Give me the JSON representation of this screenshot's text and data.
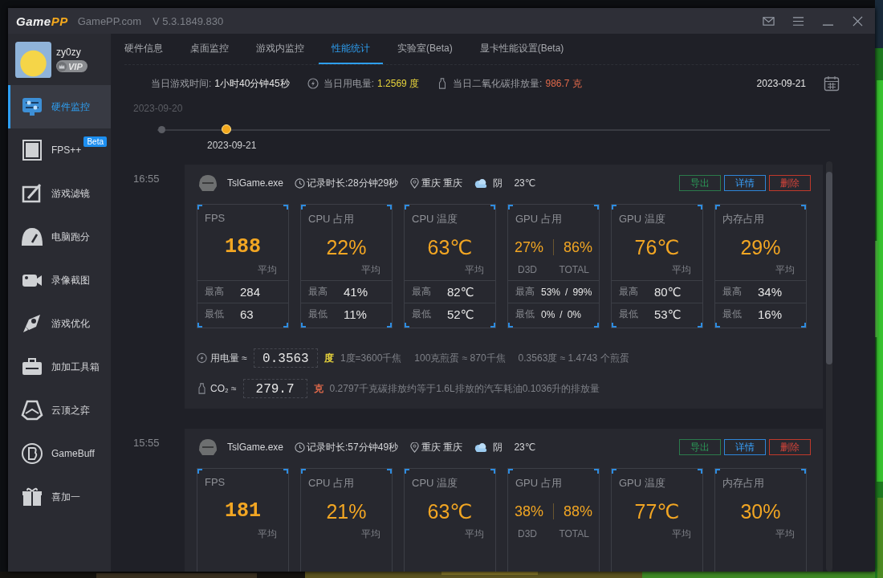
{
  "window": {
    "logo": "GamePP",
    "site": "GamePP.com",
    "version": "V 5.3.1849.830"
  },
  "user": {
    "name": "zy0zy",
    "badge": "VIP"
  },
  "sidebar": {
    "items": [
      {
        "label": "硬件监控",
        "selected": true
      },
      {
        "label": "FPS++",
        "selected": false,
        "badge": "Beta"
      },
      {
        "label": "游戏滤镜",
        "selected": false
      },
      {
        "label": "电脑跑分",
        "selected": false
      },
      {
        "label": "录像截图",
        "selected": false
      },
      {
        "label": "游戏优化",
        "selected": false
      },
      {
        "label": "加加工具箱",
        "selected": false
      },
      {
        "label": "云顶之弈",
        "selected": false
      },
      {
        "label": "GameBuff",
        "selected": false
      },
      {
        "label": "喜加一",
        "selected": false
      }
    ]
  },
  "tabs": [
    {
      "label": "硬件信息",
      "selected": false
    },
    {
      "label": "桌面监控",
      "selected": false
    },
    {
      "label": "游戏内监控",
      "selected": false
    },
    {
      "label": "性能统计",
      "selected": true
    },
    {
      "label": "实验室(Beta)",
      "selected": false
    },
    {
      "label": "显卡性能设置(Beta)",
      "selected": false
    }
  ],
  "summary": {
    "play_time_label": "当日游戏时间:",
    "play_time": "1小时40分钟45秒",
    "power_label": "当日用电量:",
    "power": "1.2569 度",
    "co2_label": "当日二氧化碳排放量:",
    "co2": "986.7 克",
    "date": "2023-09-21"
  },
  "timeline": [
    {
      "date": "2023-09-20",
      "selected": false
    },
    {
      "date": "2023-09-21",
      "selected": true
    }
  ],
  "sessions": [
    {
      "time": "16:55",
      "process": "TslGame.exe",
      "duration": "记录时长:28分钟29秒",
      "location": "重庆 重庆",
      "weather": "阴",
      "temperature": "23℃",
      "buttons": [
        {
          "kind": "export",
          "label": "导出"
        },
        {
          "kind": "detail",
          "label": "详情"
        },
        {
          "kind": "delete",
          "label": "删除"
        }
      ],
      "metrics": [
        {
          "kind": "single",
          "label": "FPS",
          "value": "188",
          "avg_label": "平均",
          "max_label": "最高",
          "max": "284",
          "min_label": "最低",
          "min": "63"
        },
        {
          "kind": "single",
          "label": "CPU 占用",
          "value": "22%",
          "avg_label": "平均",
          "max_label": "最高",
          "max": "41%",
          "min_label": "最低",
          "min": "11%"
        },
        {
          "kind": "single",
          "label": "CPU 温度",
          "value": "63℃",
          "avg_label": "平均",
          "max_label": "最高",
          "max": "82℃",
          "min_label": "最低",
          "min": "52℃"
        },
        {
          "kind": "dual",
          "label": "GPU 占用",
          "values": [
            "27%",
            "86%"
          ],
          "sub_labels": [
            "D3D",
            "TOTAL"
          ],
          "separator": "/",
          "max_label": "最高",
          "max": [
            "53%",
            "99%"
          ],
          "min_label": "最低",
          "min": [
            "0%",
            "0%"
          ]
        },
        {
          "kind": "single",
          "label": "GPU 温度",
          "value": "76℃",
          "avg_label": "平均",
          "max_label": "最高",
          "max": "80℃",
          "min_label": "最低",
          "min": "53℃"
        },
        {
          "kind": "single",
          "label": "内存占用",
          "value": "29%",
          "avg_label": "平均",
          "max_label": "最高",
          "max": "34%",
          "min_label": "最低",
          "min": "16%"
        }
      ],
      "power": {
        "label": "用电量 ≈",
        "value": "0.3563",
        "unit": "度",
        "notes": [
          "1度=3600千焦",
          "100克煎蛋 ≈ 870千焦",
          "0.3563度 ≈ 1.4743 个煎蛋"
        ]
      },
      "co2": {
        "label": "CO₂ ≈",
        "value": "279.7",
        "unit": "克",
        "notes": [
          "0.2797千克碳排放约等于1.6L排放的汽车耗油0.1036升的排放量"
        ]
      }
    },
    {
      "time": "15:55",
      "process": "TslGame.exe",
      "duration": "记录时长:57分钟49秒",
      "location": "重庆 重庆",
      "weather": "阴",
      "temperature": "23℃",
      "buttons": [
        {
          "kind": "export",
          "label": "导出"
        },
        {
          "kind": "detail",
          "label": "详情"
        },
        {
          "kind": "delete",
          "label": "删除"
        }
      ],
      "metrics": [
        {
          "kind": "single",
          "label": "FPS",
          "value": "181",
          "avg_label": "平均"
        },
        {
          "kind": "single",
          "label": "CPU 占用",
          "value": "21%",
          "avg_label": "平均"
        },
        {
          "kind": "single",
          "label": "CPU 温度",
          "value": "63℃",
          "avg_label": "平均"
        },
        {
          "kind": "dual",
          "label": "GPU 占用",
          "values": [
            "38%",
            "88%"
          ],
          "sub_labels": [
            "D3D",
            "TOTAL"
          ]
        },
        {
          "kind": "single",
          "label": "GPU 温度",
          "value": "77℃",
          "avg_label": "平均"
        },
        {
          "kind": "single",
          "label": "内存占用",
          "value": "30%",
          "avg_label": "平均"
        }
      ]
    }
  ]
}
